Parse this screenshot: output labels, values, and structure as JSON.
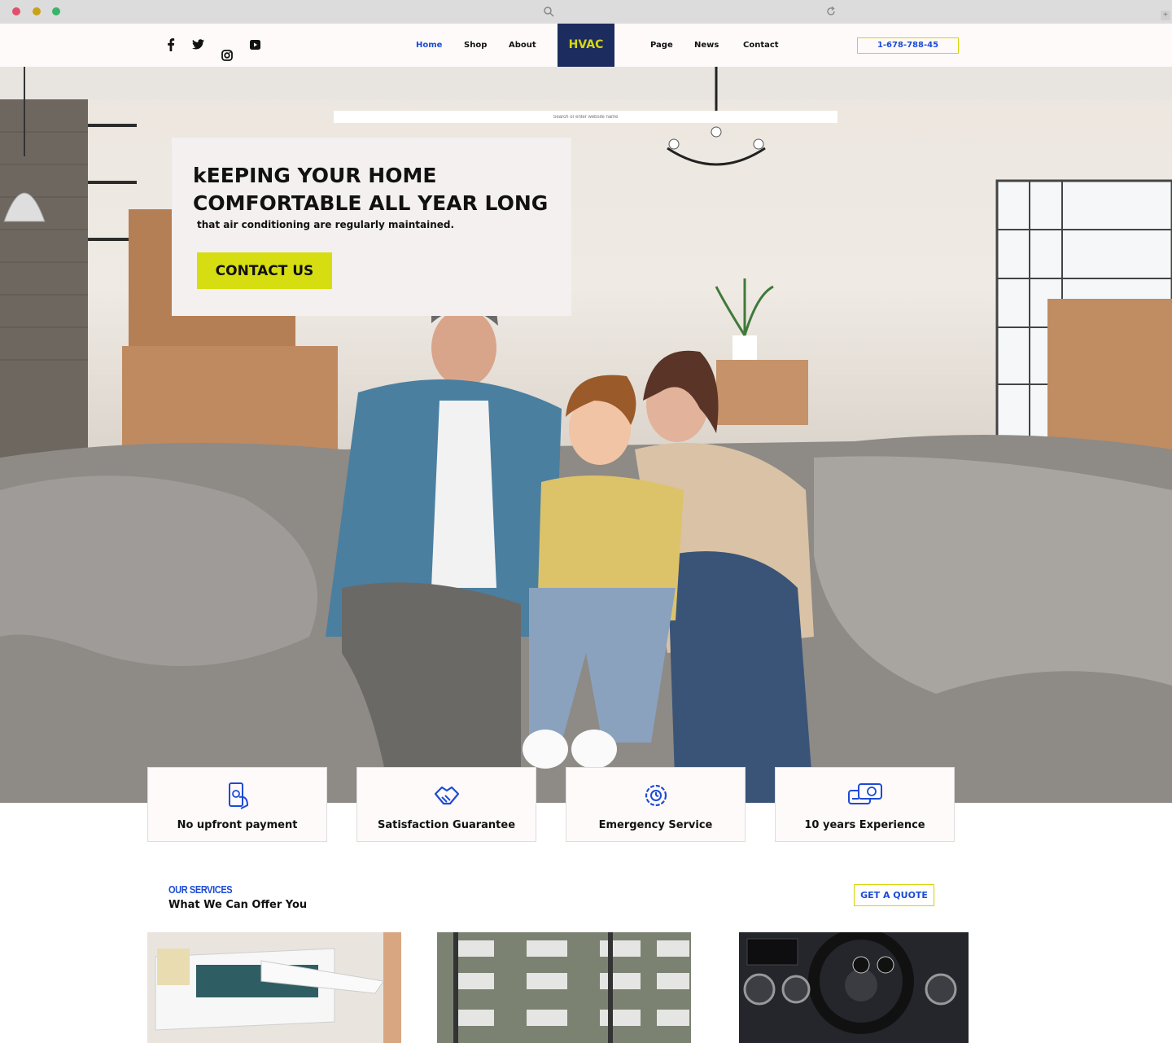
{
  "browser": {
    "search_placeholder": "Search or enter website name"
  },
  "header": {
    "social": [
      "facebook-icon",
      "twitter-icon",
      "instagram-icon",
      "youtube-icon"
    ],
    "nav_left": [
      "Home",
      "Shop",
      "About"
    ],
    "nav_right": [
      "Page",
      "News",
      "Contact"
    ],
    "active": "Home",
    "logo_text": "HVAC",
    "phone": "1-678-788-45"
  },
  "hero": {
    "title": "kEEPING YOUR HOME\nCOMFORTABLE ALL YEAR LONG",
    "subtitle": "that air conditioning are regularly maintained.",
    "cta": "CONTACT US"
  },
  "features": [
    {
      "icon": "phone-payment-icon",
      "label": "No upfront payment"
    },
    {
      "icon": "handshake-icon",
      "label": "Satisfaction Guarantee"
    },
    {
      "icon": "emergency-clock-icon",
      "label": "Emergency Service"
    },
    {
      "icon": "credit-card-icon",
      "label": "10 years Experience"
    }
  ],
  "services": {
    "eyebrow": "OUR SERVICES",
    "title": "What We Can Offer You",
    "quote_button": "GET A QUOTE"
  },
  "colors": {
    "accent_blue": "#1d4bd6",
    "accent_yellow": "#d6de12",
    "logo_navy": "#1c2c5e"
  }
}
